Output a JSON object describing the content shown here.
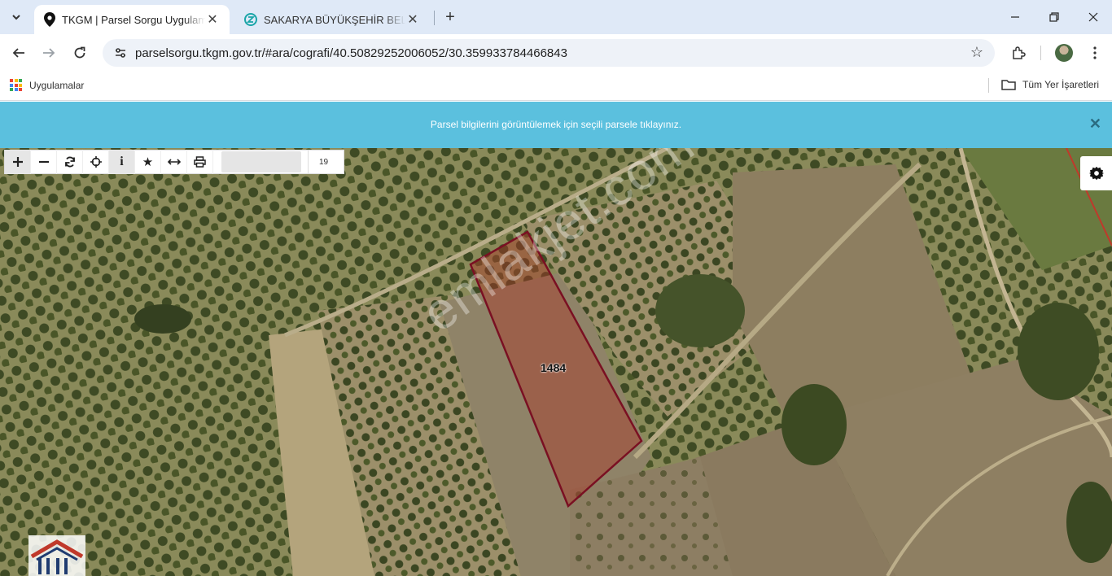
{
  "browser": {
    "tabs": [
      {
        "title": "TKGM | Parsel Sorgu Uygulaması",
        "active": true,
        "icon": "map-pin-icon"
      },
      {
        "title": "SAKARYA BÜYÜKŞEHİR BELEDİYESİ",
        "active": false,
        "icon": "sbb-favicon"
      }
    ],
    "url": "parselsorgu.tkgm.gov.tr/#ara/cografi/40.50829252006052/30.359933784466843",
    "bookmarks": {
      "apps_label": "Uygulamalar",
      "all_label": "Tüm Yer İşaretleri"
    }
  },
  "banner": {
    "message": "Parsel bilgilerini görüntülemek için seçili parsele tıklayınız.",
    "color": "#5bc0de"
  },
  "map": {
    "zoom_level": "19",
    "parcel_number": "1484",
    "parcel_outline_color": "#7a1022",
    "watermark": "emlakjet.com",
    "tools": [
      {
        "name": "zoom-in",
        "icon": "plus-icon"
      },
      {
        "name": "zoom-out",
        "icon": "minus-icon"
      },
      {
        "name": "refresh",
        "icon": "refresh-icon"
      },
      {
        "name": "locate",
        "icon": "crosshair-icon"
      },
      {
        "name": "info",
        "icon": "info-icon"
      },
      {
        "name": "favorites",
        "icon": "star-icon"
      },
      {
        "name": "measure",
        "icon": "arrows-horizontal-icon"
      },
      {
        "name": "print",
        "icon": "print-icon"
      }
    ]
  }
}
